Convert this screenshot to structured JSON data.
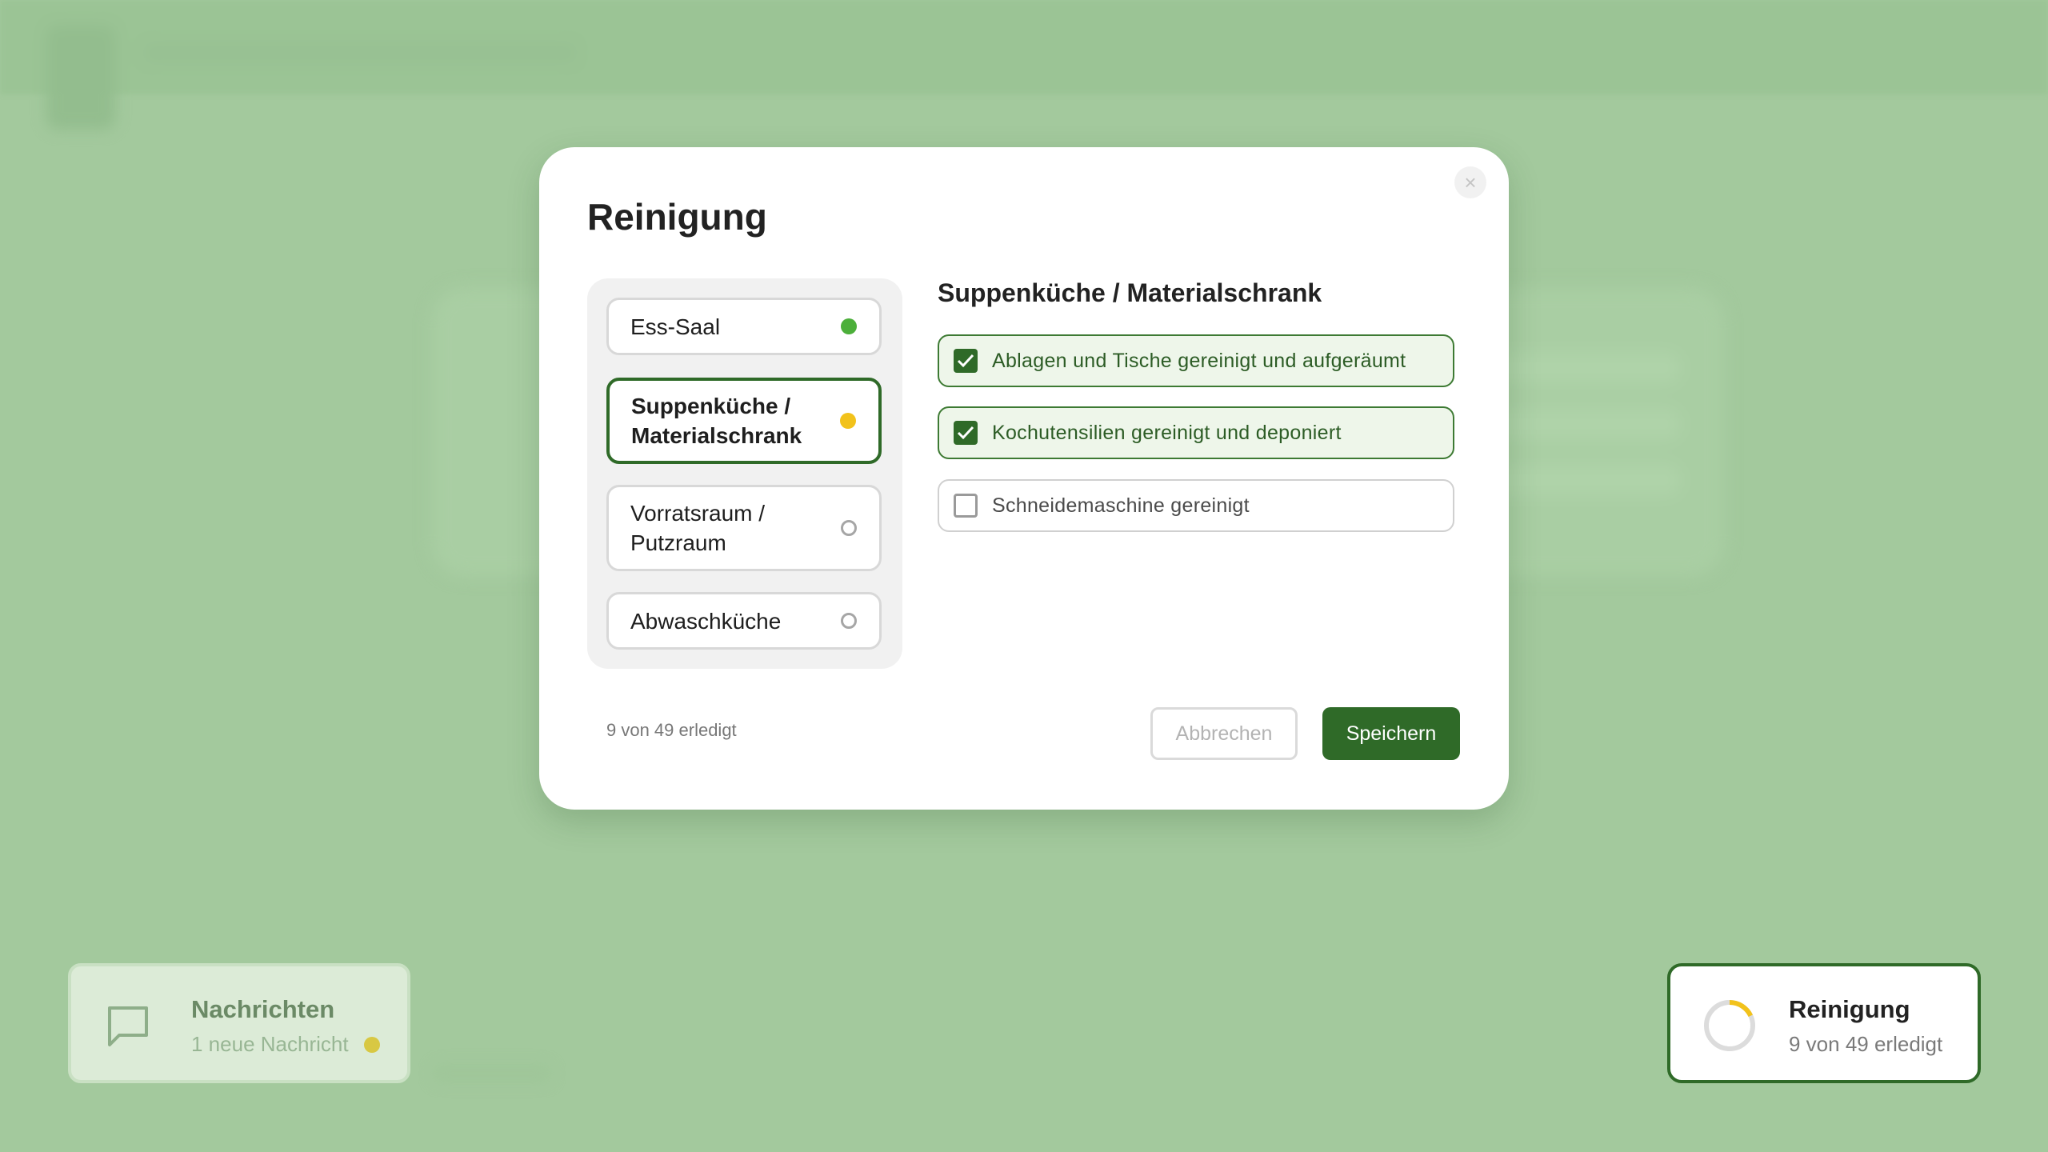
{
  "modal": {
    "title": "Reinigung",
    "close_icon": "close-icon",
    "zones": [
      {
        "label": "Ess-Saal",
        "status": "complete",
        "color": "#4caf3a"
      },
      {
        "label": "Suppenküche / Materialschrank",
        "status": "in-progress",
        "color": "#f2c21b",
        "selected": true
      },
      {
        "label": "Vorratsraum / Putzraum",
        "status": "open"
      },
      {
        "label": "Abwaschküche",
        "status": "open"
      }
    ],
    "detail": {
      "title": "Suppenküche / Materialschrank",
      "tasks": [
        {
          "label": "Ablagen und Tische gereinigt und aufgeräumt",
          "checked": true
        },
        {
          "label": "Kochutensilien gereinigt und deponiert",
          "checked": true
        },
        {
          "label": "Schneidemaschine gereinigt",
          "checked": false
        }
      ]
    },
    "progress_text": "9 von 49 erledigt",
    "cancel_label": "Abbrechen",
    "save_label": "Speichern"
  },
  "widgets": {
    "messages": {
      "icon": "chat-bubble-icon",
      "title": "Nachrichten",
      "subtitle": "1 neue Nachricht"
    },
    "cleaning": {
      "icon": "progress-ring-icon",
      "title": "Reinigung",
      "subtitle": "9 von 49 erledigt",
      "progress": 0.18
    }
  },
  "colors": {
    "accent": "#2f6a28",
    "background": "#a3c99d"
  }
}
